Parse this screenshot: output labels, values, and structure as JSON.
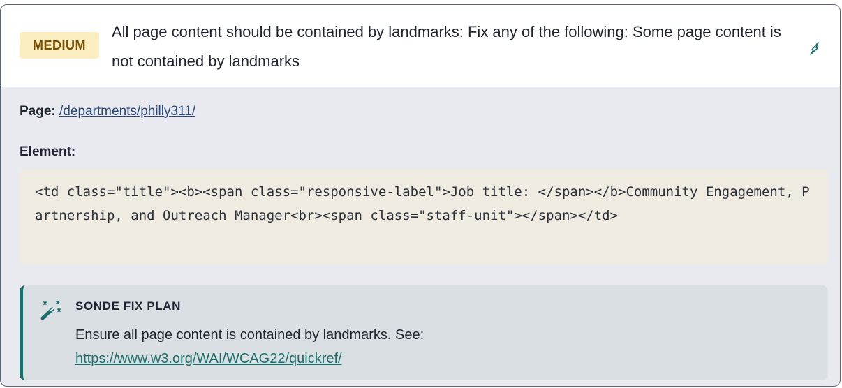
{
  "issue": {
    "severity": "MEDIUM",
    "title": "All page content should be contained by landmarks: Fix any of the following: Some page content is not contained by landmarks",
    "edit_icon": "pencil-edit-icon"
  },
  "details": {
    "page_label": "Page:",
    "page_link": "/departments/philly311/",
    "element_label": "Element:",
    "code": "<td class=\"title\"><b><span class=\"responsive-label\">Job title: </span></b>Community Engagement, Partnership, and Outreach Manager<br><span class=\"staff-unit\"></span></td>"
  },
  "fix_plan": {
    "icon": "magic-wand-sparkle-icon",
    "title": "SONDE FIX PLAN",
    "text": "Ensure all page content is contained by landmarks. See:",
    "link": "https://www.w3.org/WAI/WCAG22/quickref/"
  },
  "colors": {
    "severity_bg": "#fbefc2",
    "severity_text": "#7a4f00",
    "accent_teal": "#1b6f6b",
    "code_bg": "#efebe1",
    "panel_bg": "#e8eaef"
  }
}
